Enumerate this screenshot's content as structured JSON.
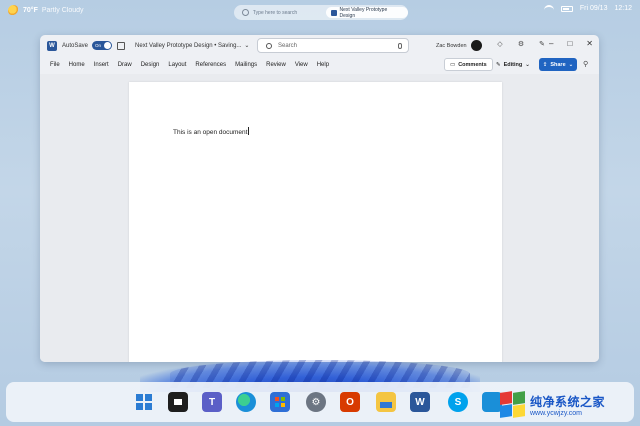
{
  "topbar": {
    "weather_temp": "70°F",
    "weather_condition": "Partly Cloudy",
    "search_placeholder": "Type here to search",
    "search_chip": "Next Valley Prototype Design",
    "date": "Fri 09/13",
    "time": "12:12"
  },
  "window": {
    "title_autosave": "AutoSave",
    "autosave_state": "On",
    "doc_title": "Next Valley Prototype Design • Saving...",
    "search_label": "Search",
    "user_name": "Zac Bowden",
    "menu": [
      "File",
      "Home",
      "Insert",
      "Draw",
      "Design",
      "Layout",
      "References",
      "Mailings",
      "Review",
      "View",
      "Help"
    ],
    "comments_label": "Comments",
    "editing_label": "Editing",
    "share_label": "Share"
  },
  "document": {
    "body_text": "This is an open document"
  },
  "taskbar": {
    "apps": [
      "start",
      "terminal",
      "teams",
      "edge",
      "store",
      "settings",
      "office",
      "file-explorer",
      "word",
      "skype",
      "extra"
    ]
  },
  "watermark": {
    "title": "纯净系统之家",
    "url": "www.ycwjzy.com"
  }
}
